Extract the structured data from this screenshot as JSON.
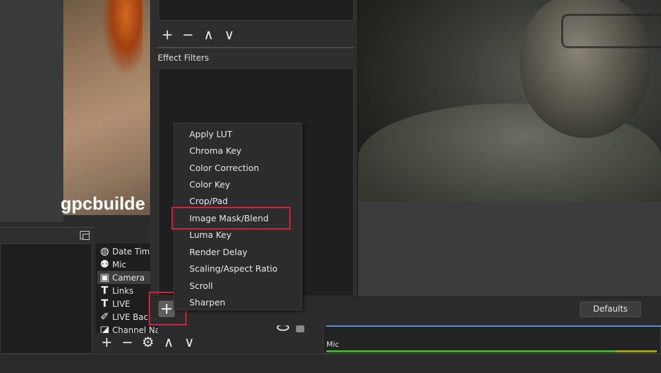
{
  "preview": {
    "watermark_text": "gpcbuilde"
  },
  "sources": {
    "items": [
      {
        "label": "Date Tim",
        "icon": "globe-icon",
        "glyph": "◍"
      },
      {
        "label": "Mic",
        "icon": "microphone-icon",
        "glyph": "⚉"
      },
      {
        "label": "Camera",
        "icon": "camera-icon",
        "glyph": "▣",
        "selected": true
      },
      {
        "label": "Links",
        "icon": "text-icon",
        "glyph": "T"
      },
      {
        "label": "LIVE",
        "icon": "text-icon",
        "glyph": "T"
      },
      {
        "label": "LIVE Bac",
        "icon": "brush-icon",
        "glyph": "✐"
      },
      {
        "label": "Channel Name",
        "icon": "image-icon",
        "glyph": "◪"
      }
    ],
    "footer_buttons": [
      "+",
      "−",
      "⚙",
      "∧",
      "∨"
    ]
  },
  "filters": {
    "audio_buttons": [
      "+",
      "−",
      "∧",
      "∨"
    ],
    "effect_filters_label": "Effect Filters",
    "add_button_label": "+",
    "defaults_label": "Defaults",
    "menu_items": [
      "Apply LUT",
      "Chroma Key",
      "Color Correction",
      "Color Key",
      "Crop/Pad",
      "Image Mask/Blend",
      "Luma Key",
      "Render Delay",
      "Scaling/Aspect Ratio",
      "Scroll",
      "Sharpen"
    ],
    "highlighted_item": "Image Mask/Blend"
  },
  "mixer": {
    "channel_label": "Mic"
  },
  "colors": {
    "highlight_border": "#d4223a",
    "mixer_accent": "#5d8ad9",
    "meter_green": "#4aa93a"
  }
}
